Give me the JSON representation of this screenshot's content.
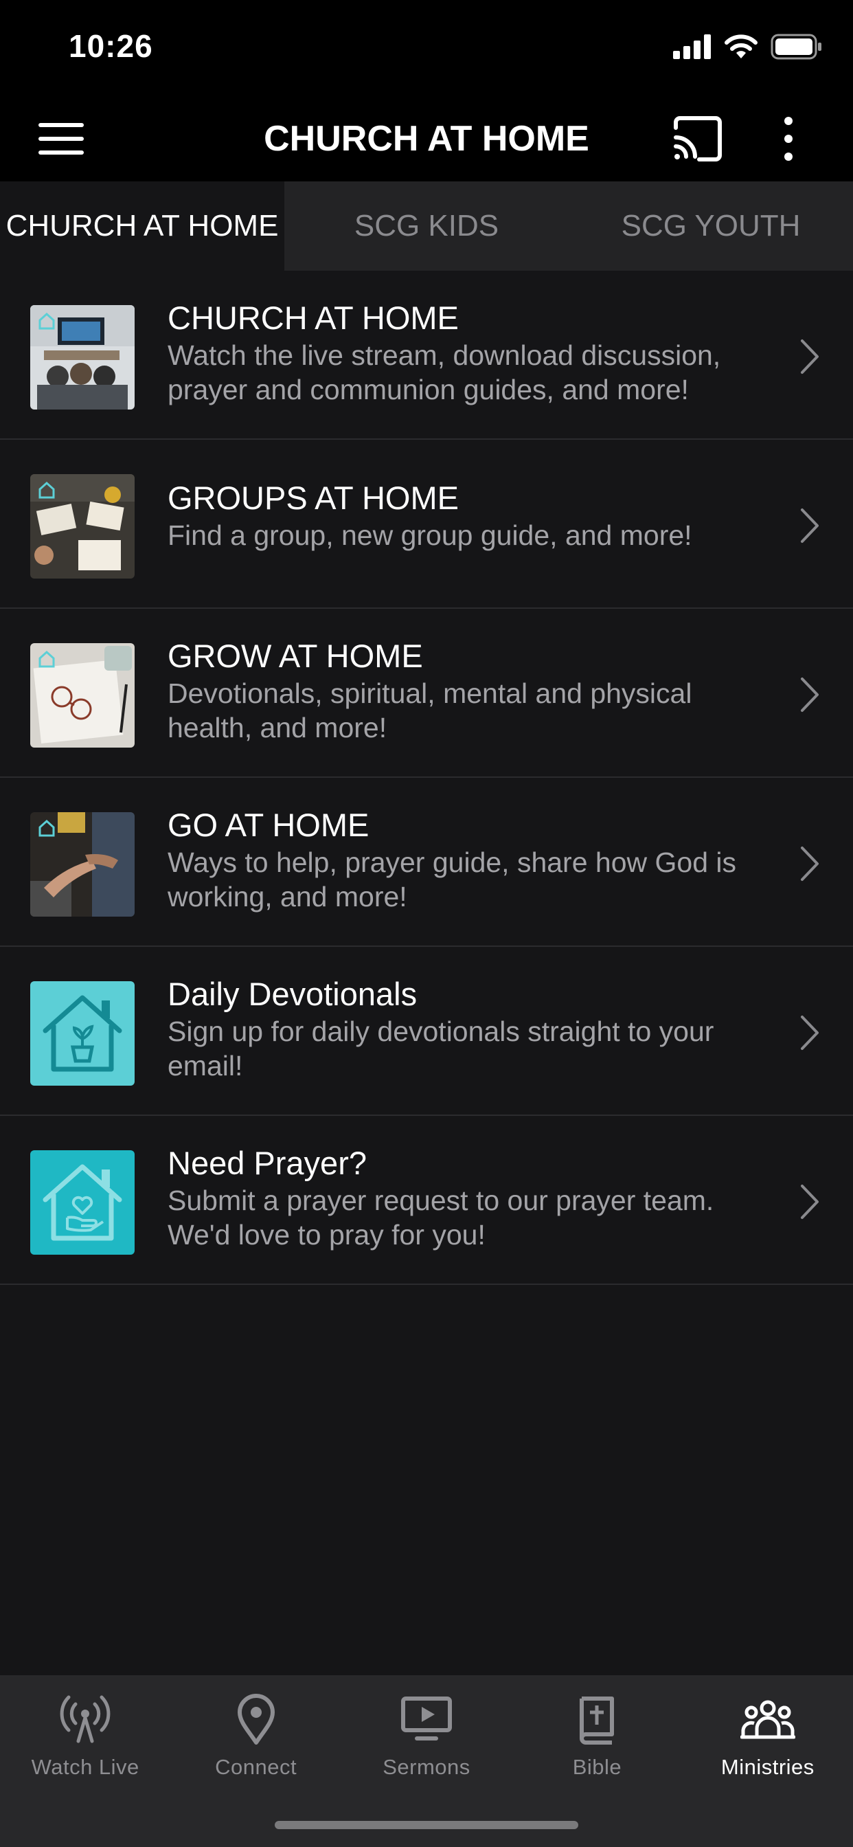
{
  "status_bar": {
    "time": "10:26"
  },
  "header": {
    "title": "CHURCH AT HOME"
  },
  "tabs": [
    {
      "label": "CHURCH AT HOME",
      "active": true
    },
    {
      "label": "SCG KIDS",
      "active": false
    },
    {
      "label": "SCG YOUTH",
      "active": false
    }
  ],
  "list": [
    {
      "title": "CHURCH AT HOME",
      "desc": "Watch the live stream, download discussion, prayer and communion guides, and more!",
      "thumb": "tv-living-room-image"
    },
    {
      "title": "GROUPS AT HOME",
      "desc": "Find a group, new group guide, and more!",
      "thumb": "bible-study-group-image"
    },
    {
      "title": "GROW AT HOME",
      "desc": "Devotionals, spiritual, mental and physical health, and more!",
      "thumb": "notebook-glasses-image"
    },
    {
      "title": "GO AT HOME",
      "desc": "Ways to help, prayer guide, share how God is working, and more!",
      "thumb": "helping-hands-image"
    },
    {
      "title": "Daily Devotionals",
      "desc": "Sign up for daily devotionals straight to your email!",
      "thumb": "house-plant-icon"
    },
    {
      "title": "Need Prayer?",
      "desc": "Submit a prayer request to our prayer team. We'd love to pray for you!",
      "thumb": "house-heart-hand-icon"
    }
  ],
  "tabbar": [
    {
      "label": "Watch Live",
      "icon": "broadcast-icon",
      "active": false
    },
    {
      "label": "Connect",
      "icon": "map-pin-icon",
      "active": false
    },
    {
      "label": "Sermons",
      "icon": "play-screen-icon",
      "active": false
    },
    {
      "label": "Bible",
      "icon": "bible-icon",
      "active": false
    },
    {
      "label": "Ministries",
      "icon": "people-group-icon",
      "active": true
    }
  ],
  "colors": {
    "accent_teal": "#5ccfd6",
    "accent_teal_dark": "#1fb8c4",
    "background": "#151517",
    "header": "#000000",
    "tabbar": "#28282a"
  }
}
